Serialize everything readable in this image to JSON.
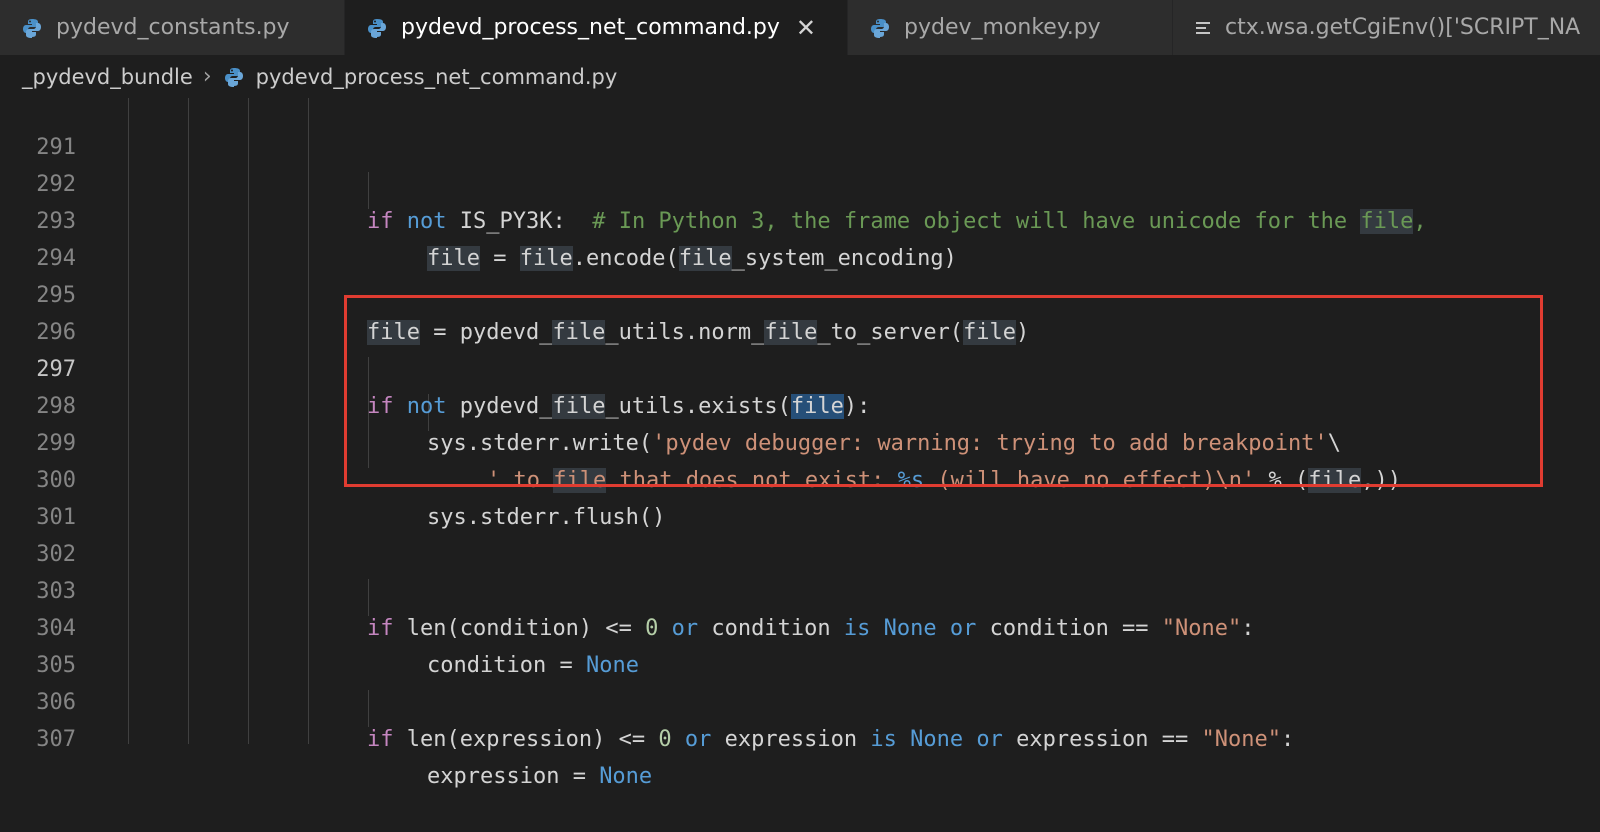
{
  "tabs": [
    {
      "label": "pydevd_constants.py",
      "icon": "python-icon",
      "active": false
    },
    {
      "label": "pydevd_process_net_command.py",
      "icon": "python-icon",
      "active": true,
      "close": "✕"
    },
    {
      "label": "pydev_monkey.py",
      "icon": "python-icon",
      "active": false
    },
    {
      "label": "ctx.wsa.getCgiEnv()['SCRIPT_NA",
      "icon": "text-file-icon",
      "active": false
    }
  ],
  "breadcrumb": {
    "folder": "_pydevd_bundle",
    "separator": "›",
    "file": "pydevd_process_net_command.py"
  },
  "line_numbers": [
    "291",
    "292",
    "293",
    "294",
    "295",
    "296",
    "297",
    "298",
    "299",
    "300",
    "301",
    "302",
    "303",
    "304",
    "305",
    "306",
    "307"
  ],
  "code": {
    "l292": {
      "kw_if": "if",
      "kw_not": " not",
      "sp1": " ",
      "const": "IS_PY3K",
      "colon": ":  ",
      "comment_a": "# In Python 3, the frame object will have unicode for the ",
      "comment_file": "file",
      "comment_b": ","
    },
    "l293": {
      "file1": "file",
      "eq": " = ",
      "file2": "file",
      "enc": ".encode(",
      "file3": "file",
      "rest": "_system_encoding)"
    },
    "l295": {
      "file1": "file",
      "eq": " = pydevd_",
      "file2": "file",
      "mid": "_utils.norm_",
      "file3": "file",
      "mid2": "_to_server(",
      "file4": "file",
      "end": ")"
    },
    "l297": {
      "kw_if": "if",
      "kw_not": " not",
      "a": " pydevd_",
      "file1": "file",
      "b": "_utils.exists(",
      "file2": "file",
      "c": "):"
    },
    "l298": {
      "a": "sys.stderr.write(",
      "s": "'pydev debugger: warning: trying to add breakpoint'",
      "b": "\\"
    },
    "l299": {
      "s1": "' to ",
      "file1": "file",
      "s2": " that does not exist: ",
      "fmt": "%s",
      "s3": " (will have no effect)\\n'",
      "op": " % (",
      "file2": "file",
      "end": ",))"
    },
    "l300": {
      "a": "sys.stderr.flush()"
    },
    "l303": {
      "kw_if": "if",
      "a": " len(condition) <= ",
      "num": "0",
      "kw_or1": " or",
      "b": " condition ",
      "kw_is": "is",
      "kw_none": " None",
      "kw_or2": " or",
      "c": " condition == ",
      "s": "\"None\"",
      "d": ":"
    },
    "l304": {
      "a": "condition = ",
      "kw_none": "None"
    },
    "l306": {
      "kw_if": "if",
      "a": " len(expression) <= ",
      "num": "0",
      "kw_or1": " or",
      "b": " expression ",
      "kw_is": "is",
      "kw_none": " None",
      "kw_or2": " or",
      "c": " expression == ",
      "s": "\"None\"",
      "d": ":"
    },
    "l307": {
      "a": "expression = ",
      "kw_none": "None"
    }
  },
  "colors": {
    "background": "#1e1e1e",
    "keyword": "#c586c0",
    "builtin": "#569cd6",
    "comment": "#6a9955",
    "string": "#ce9178",
    "number": "#b5cea8",
    "annotation_box": "#e03c31",
    "python_icon": "#4a90c8"
  }
}
